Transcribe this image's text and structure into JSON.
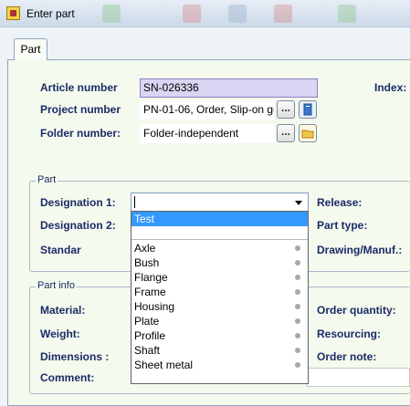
{
  "window": {
    "title": "Enter part"
  },
  "tabs": [
    {
      "label": "Part"
    }
  ],
  "header": {
    "article_label": "Article number",
    "article_value": "SN-026336",
    "index_label": "Index:",
    "project_label": "Project number",
    "project_value": "PN-01-06, Order, Slip-on ge",
    "folder_label": "Folder number:",
    "folder_value": "Folder-independent",
    "browse_label": "..."
  },
  "part_group": {
    "title": "Part",
    "designation1_label": "Designation 1:",
    "designation1_value": "",
    "designation2_label": "Designation 2:",
    "standard_label": "Standar",
    "release_label": "Release:",
    "part_type_label": "Part type:",
    "drawing_label": "Drawing/Manuf.:"
  },
  "dropdown": {
    "selected": "Test",
    "items": [
      "Axle",
      "Bush",
      "Flange",
      "Frame",
      "Housing",
      "Plate",
      "Profile",
      "Shaft",
      "Sheet metal"
    ]
  },
  "part_info_group": {
    "title": "Part info",
    "material_label": "Material:",
    "weight_label": "Weight:",
    "dimensions_label": "Dimensions :",
    "comment_label": "Comment:",
    "order_quantity_label": "Order quantity:",
    "resourcing_label": "Resourcing:",
    "order_note_label": "Order note:"
  },
  "colors": {
    "selection": "#3399ff",
    "label_text": "#1b2b66",
    "article_field": "#dcd4f3"
  }
}
